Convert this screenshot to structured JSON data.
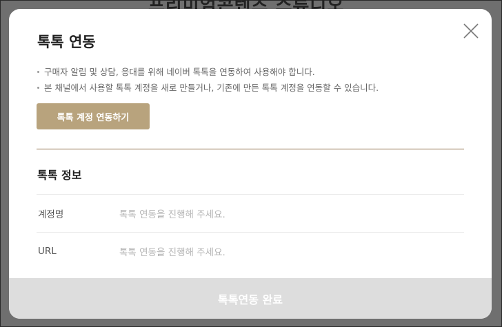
{
  "background": {
    "title": "프리미엄콘텐츠 스튜디오"
  },
  "modal": {
    "title": "톡톡 연동",
    "close_icon": "close-icon",
    "descriptions": [
      "구매자 알림 및 상담, 응대를 위해 네이버 톡톡을 연동하여 사용해야 합니다.",
      "본 채널에서 사용할 톡톡 계정을 새로 만들거나, 기존에 만든 톡톡 계정을 연동할 수 있습니다."
    ],
    "connect_button_label": "톡톡 계정 연동하기",
    "section_title": "톡톡 정보",
    "rows": [
      {
        "label": "계정명",
        "value": "톡톡 연동을 진행해 주세요."
      },
      {
        "label": "URL",
        "value": "톡톡 연동을 진행해 주세요."
      }
    ],
    "footer_button_label": "톡톡연동 완료"
  },
  "colors": {
    "accent": "#b8a37d",
    "divider": "#8a6a45",
    "footer_disabled": "#dddddd",
    "overlay": "#6f6f6f"
  }
}
